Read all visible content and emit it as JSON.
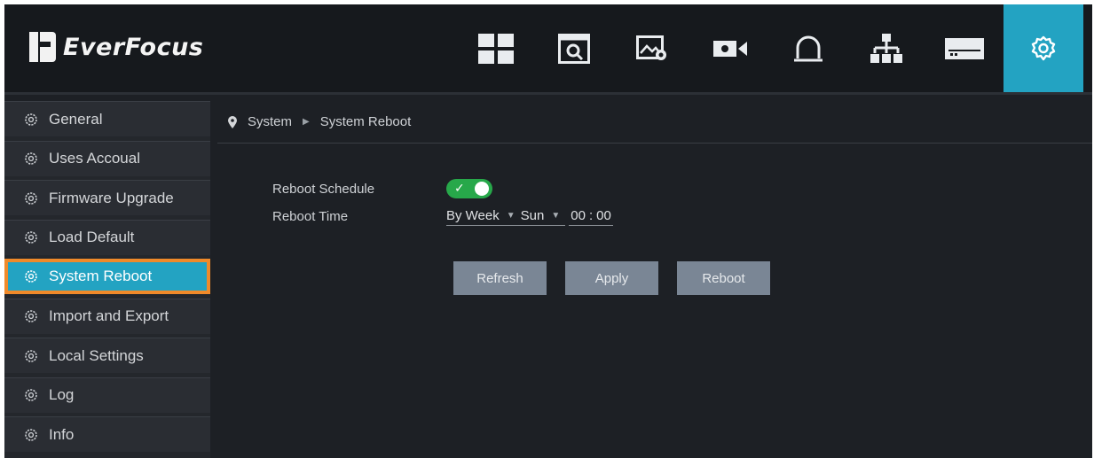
{
  "brand": {
    "name": "EverFocus"
  },
  "colors": {
    "accent": "#23a3c2",
    "highlight": "#f08a2a",
    "toggle_on": "#27a84a",
    "button": "#7a8695"
  },
  "top_nav": [
    {
      "icon": "live-view-grid-icon",
      "active": false
    },
    {
      "icon": "playback-search-icon",
      "active": false
    },
    {
      "icon": "image-settings-icon",
      "active": false
    },
    {
      "icon": "camera-icon",
      "active": false
    },
    {
      "icon": "alarm-bell-icon",
      "active": false
    },
    {
      "icon": "network-icon",
      "active": false
    },
    {
      "icon": "storage-icon",
      "active": false
    },
    {
      "icon": "system-settings-icon",
      "active": true
    }
  ],
  "sidebar": {
    "items": [
      {
        "label": "General",
        "active": false
      },
      {
        "label": "Uses Accoual",
        "active": false
      },
      {
        "label": "Firmware Upgrade",
        "active": false
      },
      {
        "label": "Load Default",
        "active": false
      },
      {
        "label": "System Reboot",
        "active": true
      },
      {
        "label": "Import and Export",
        "active": false
      },
      {
        "label": "Local Settings",
        "active": false
      },
      {
        "label": "Log",
        "active": false
      },
      {
        "label": "Info",
        "active": false
      }
    ]
  },
  "breadcrumb": {
    "root": "System",
    "current": "System Reboot"
  },
  "form": {
    "reboot_schedule_label": "Reboot Schedule",
    "reboot_schedule_enabled": true,
    "reboot_time_label": "Reboot Time",
    "frequency_value": "By Week",
    "day_value": "Sun",
    "hour_value": "00",
    "time_separator": ":",
    "minute_value": "00"
  },
  "buttons": {
    "refresh": "Refresh",
    "apply": "Apply",
    "reboot": "Reboot"
  }
}
